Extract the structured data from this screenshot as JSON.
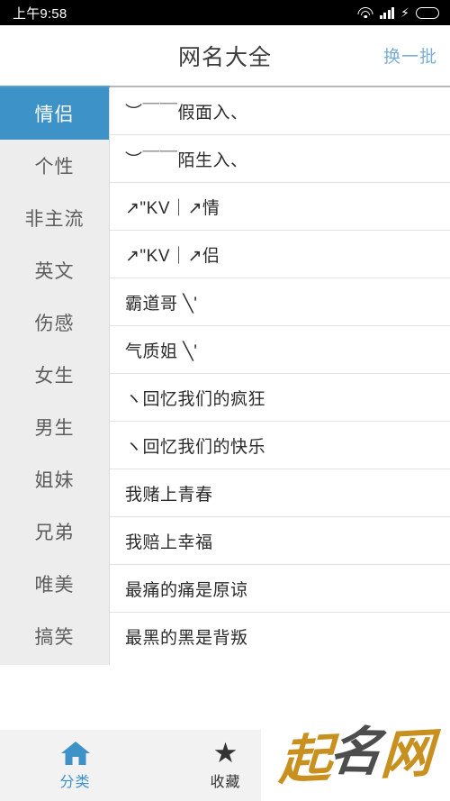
{
  "statusbar": {
    "time": "上午9:58",
    "icons": [
      "wifi-icon",
      "signal-icon",
      "charging-bolt-icon",
      "battery-icon"
    ]
  },
  "header": {
    "title": "网名大全",
    "action_label": "换一批"
  },
  "sidebar": {
    "items": [
      {
        "label": "情侣",
        "active": true
      },
      {
        "label": "个性",
        "active": false
      },
      {
        "label": "非主流",
        "active": false
      },
      {
        "label": "英文",
        "active": false
      },
      {
        "label": "伤感",
        "active": false
      },
      {
        "label": "女生",
        "active": false
      },
      {
        "label": "男生",
        "active": false
      },
      {
        "label": "姐妹",
        "active": false
      },
      {
        "label": "兄弟",
        "active": false
      },
      {
        "label": "唯美",
        "active": false
      },
      {
        "label": "搞笑",
        "active": false
      }
    ]
  },
  "list": {
    "rows": [
      {
        "text": "︶￣￣假面入、"
      },
      {
        "text": "︶￣￣陌生入、"
      },
      {
        "text": "↗\"KV｜↗情"
      },
      {
        "text": "↗\"KV｜↗侣"
      },
      {
        "text": "霸道哥 ╲'"
      },
      {
        "text": "气质姐 ╲'"
      },
      {
        "text": "ヽ回忆我们的疯狂"
      },
      {
        "text": "ヽ回忆我们的快乐"
      },
      {
        "text": "我赌上青春"
      },
      {
        "text": "我赔上幸福"
      },
      {
        "text": "最痛的痛是原谅"
      },
      {
        "text": "最黑的黑是背叛"
      }
    ]
  },
  "tabbar": {
    "tabs": [
      {
        "label": "分类",
        "icon": "home-icon",
        "active": true
      },
      {
        "label": "收藏",
        "icon": "star-icon",
        "active": false
      }
    ]
  },
  "watermark": {
    "char1": "起",
    "char2": "名",
    "char3": "网"
  },
  "colors": {
    "accent_blue": "#3d92c8",
    "link_blue": "#79aed4",
    "sidebar_bg": "#ededed",
    "tabbar_bg": "#f2f2f2",
    "divider": "#e2e2e2",
    "watermark_gold": "#c8901e",
    "watermark_gray": "#4d4d4d",
    "battery_green": "#3ec81e"
  }
}
